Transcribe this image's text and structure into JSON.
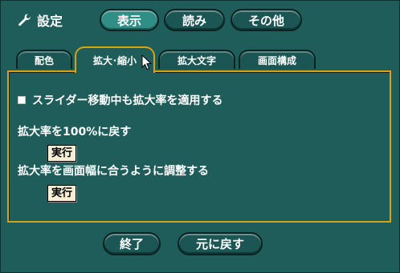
{
  "header": {
    "title": "設定",
    "title_icon": "wrench-icon",
    "mode_buttons": [
      {
        "label": "表示",
        "active": true
      },
      {
        "label": "読み",
        "active": false
      },
      {
        "label": "その他",
        "active": false
      }
    ]
  },
  "tabs": [
    {
      "label": "配色",
      "active": false
    },
    {
      "label": "拡大･縮小",
      "active": true
    },
    {
      "label": "拡大文字",
      "active": false
    },
    {
      "label": "画面構成",
      "active": false
    }
  ],
  "panel": {
    "checkbox_label": "スライダー移動中も拡大率を適用する",
    "checkbox_checked": false,
    "reset_label": "拡大率を100%に戻す",
    "reset_button": "実行",
    "fit_label": "拡大率を画面幅に合うように調整する",
    "fit_button": "実行"
  },
  "footer": {
    "close_button": "終了",
    "revert_button": "元に戻す"
  },
  "colors": {
    "background": "#1f5d5a",
    "active_accent": "#2f8f86",
    "tab_border_active": "#d7a30f",
    "text": "#ffffff"
  }
}
